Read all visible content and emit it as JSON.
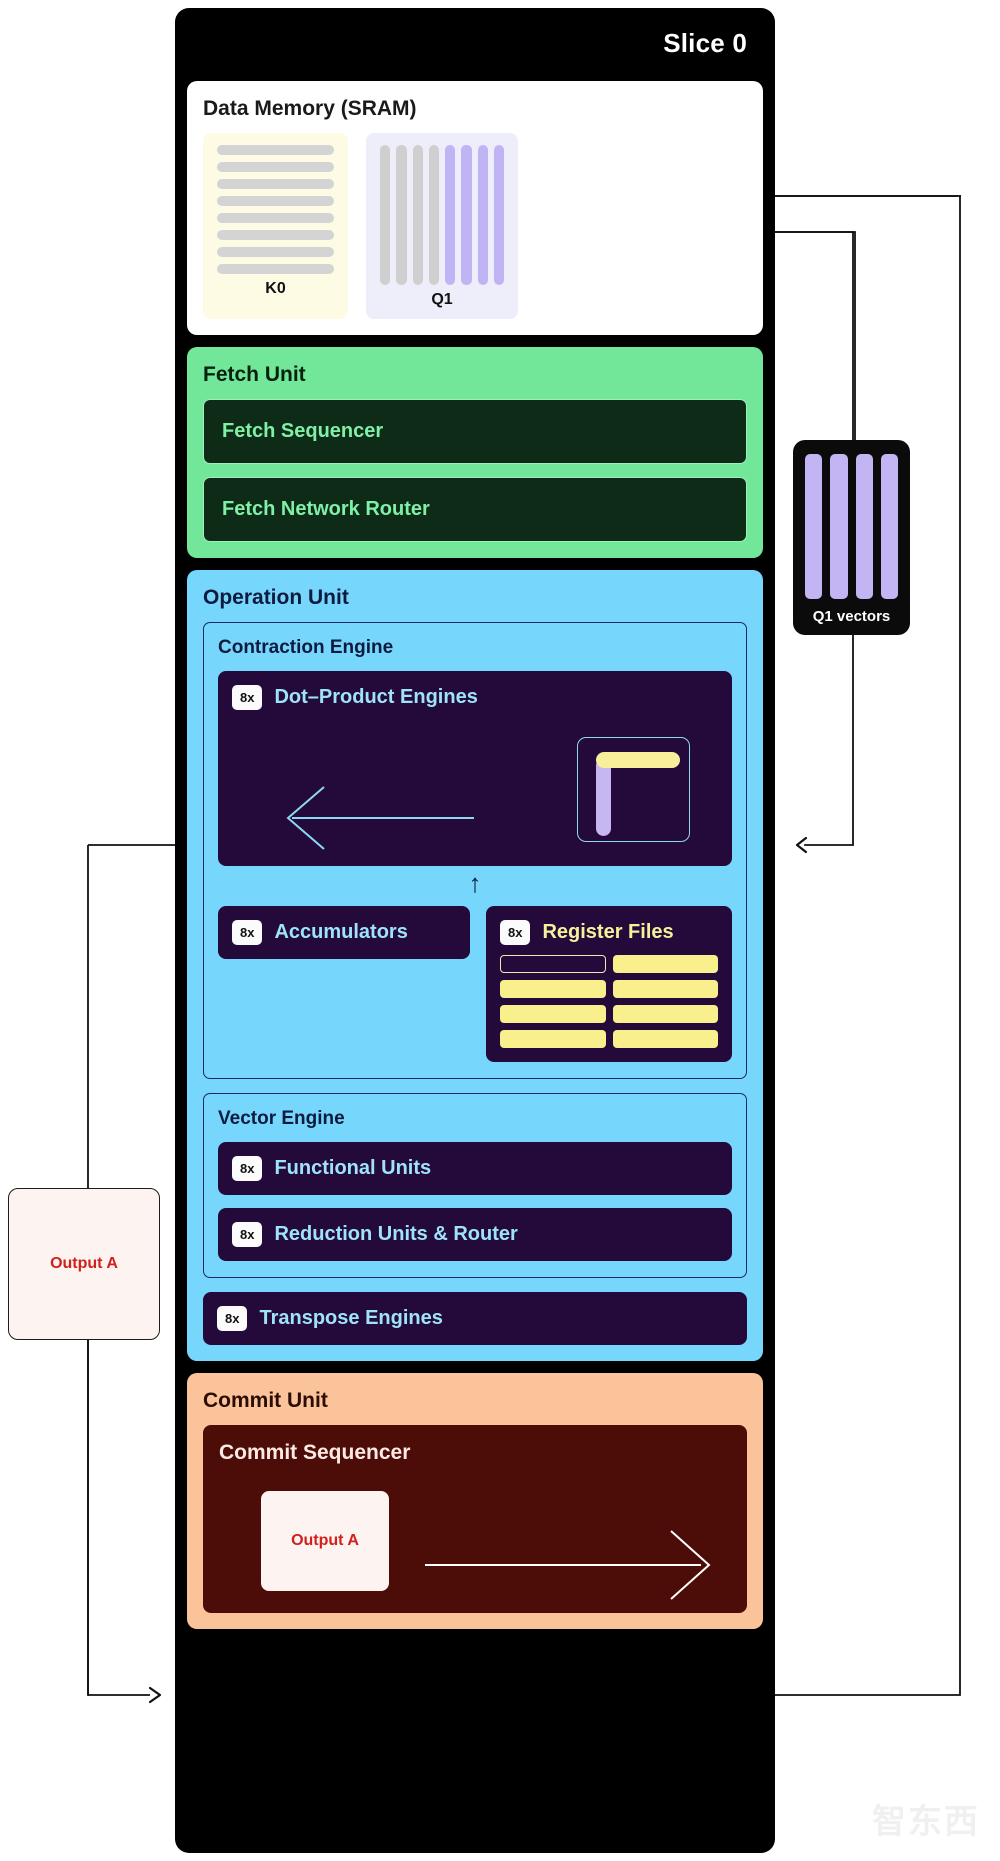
{
  "slice": {
    "title": "Slice 0"
  },
  "data_memory": {
    "title": "Data Memory (SRAM)",
    "blocks": [
      {
        "label": "K0",
        "orientation": "horizontal",
        "bar_count": 8,
        "accent_count": 0
      },
      {
        "label": "Q1",
        "orientation": "vertical",
        "bar_count": 8,
        "accent_count": 4
      }
    ]
  },
  "fetch_unit": {
    "title": "Fetch Unit",
    "items": [
      {
        "label": "Fetch Sequencer"
      },
      {
        "label": "Fetch Network Router"
      }
    ]
  },
  "operation_unit": {
    "title": "Operation Unit",
    "contraction_engine": {
      "title": "Contraction Engine",
      "dot_product": {
        "badge": "8x",
        "label": "Dot–Product Engines"
      },
      "accumulators": {
        "badge": "8x",
        "label": "Accumulators"
      },
      "register_files": {
        "badge": "8x",
        "label": "Register Files",
        "cells": [
          "outline",
          "filled",
          "filled",
          "filled",
          "filled",
          "filled",
          "filled",
          "filled"
        ]
      }
    },
    "vector_engine": {
      "title": "Vector Engine",
      "items": [
        {
          "badge": "8x",
          "label": "Functional Units"
        },
        {
          "badge": "8x",
          "label": "Reduction Units & Router"
        }
      ]
    },
    "transpose_engines": {
      "badge": "8x",
      "label": "Transpose Engines"
    }
  },
  "commit_unit": {
    "title": "Commit Unit",
    "sequencer": {
      "title": "Commit Sequencer",
      "output_card": {
        "label": "Output A"
      }
    }
  },
  "side_cards": {
    "q1_vectors": {
      "label": "Q1 vectors",
      "bar_count": 4
    },
    "output_a": {
      "label": "Output A"
    }
  },
  "watermark": {
    "text": "智东西"
  },
  "colors": {
    "chassis": "#000000",
    "fetch_unit": "#72e79a",
    "operation_unit": "#77d6fb",
    "commit_unit": "#fbc39a",
    "dark_block": "#230a3b",
    "accent_purple": "#c3b4f3",
    "accent_yellow": "#f9ef8c",
    "output_red": "#d0211c",
    "commit_dark": "#4c0d08"
  }
}
